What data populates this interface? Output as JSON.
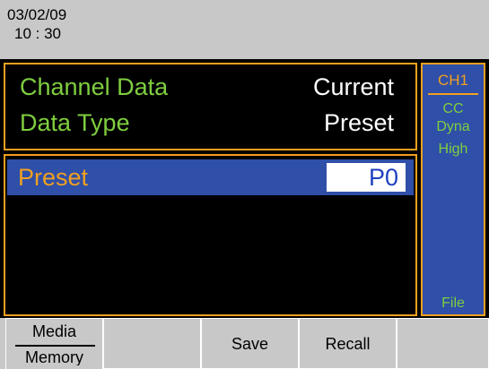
{
  "header": {
    "date": "03/02/09",
    "time": "10 : 30"
  },
  "info": {
    "channel_label": "Channel Data",
    "channel_value": "Current",
    "type_label": "Data Type",
    "type_value": "Preset"
  },
  "preset": {
    "label": "Preset",
    "value": "P0"
  },
  "side": {
    "channel": "CH1",
    "mode": "CC",
    "dyna": "Dyna",
    "range": "High",
    "file": "File"
  },
  "softkeys": {
    "media_top": "Media",
    "media_bottom": "Memory",
    "key2": "",
    "save": "Save",
    "recall": "Recall",
    "key5": ""
  },
  "colors": {
    "accent": "#f0a020",
    "label_green": "#7fce3f",
    "highlight_blue": "#2f4fa8",
    "background": "#000000",
    "header_gray": "#c8c8c8"
  }
}
